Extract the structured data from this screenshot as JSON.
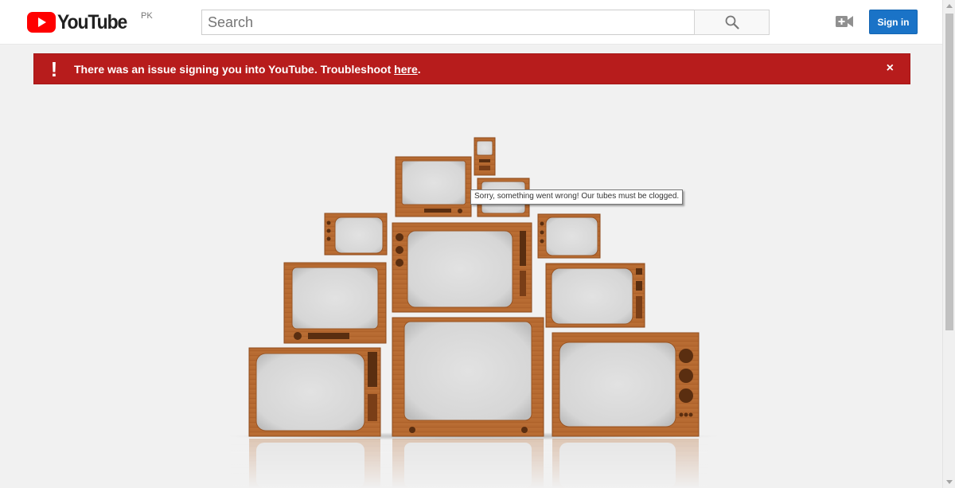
{
  "header": {
    "logo_text": "YouTube",
    "country_code": "PK",
    "search": {
      "placeholder": "Search",
      "value": ""
    },
    "signin_label": "Sign in"
  },
  "alert": {
    "message": "There was an issue signing you into YouTube. Troubleshoot ",
    "link_text": "here",
    "suffix": ".",
    "close_glyph": "×",
    "icon_glyph": "!",
    "color": "#b71c1c"
  },
  "error": {
    "tooltip": "Sorry, something went wrong! Our tubes must be clogged."
  },
  "colors": {
    "brand_red": "#ff0000",
    "signin_blue": "#1a73c7",
    "wood": "#b4642c",
    "screen": "#d7d7d7"
  },
  "icons": [
    "youtube-logo-icon",
    "search-icon",
    "upload-video-icon",
    "alert-exclamation-icon",
    "close-icon"
  ]
}
